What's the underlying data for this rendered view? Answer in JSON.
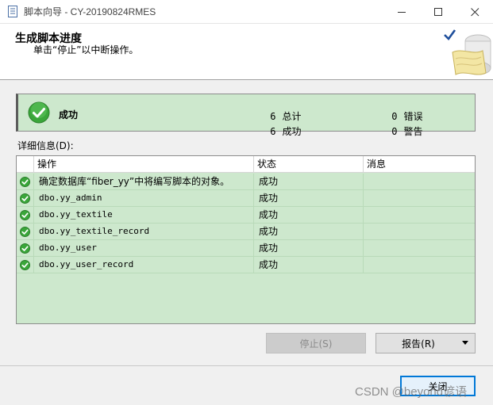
{
  "window": {
    "title": "脚本向导 - CY-20190824RMES",
    "icon": "script-doc-icon"
  },
  "header": {
    "title": "生成脚本进度",
    "subtitle": "单击“停止”以中断操作。",
    "art_icon": "checked-scroll-icon"
  },
  "summary": {
    "status": "成功",
    "status_icon": "success-check-icon",
    "total_count": "6",
    "total_label": "总计",
    "success_count": "6",
    "success_label": "成功",
    "error_count": "0",
    "error_label": "错误",
    "warning_count": "0",
    "warning_label": "警告",
    "background_color": "#cde8cd"
  },
  "details": {
    "label": "详细信息(D):",
    "columns": [
      "操作",
      "状态",
      "消息"
    ],
    "rows": [
      {
        "operation": "确定数据库“fiber_yy”中将编写脚本的对象。",
        "status": "成功",
        "message": ""
      },
      {
        "operation": "dbo.yy_admin",
        "status": "成功",
        "message": ""
      },
      {
        "operation": "dbo.yy_textile",
        "status": "成功",
        "message": ""
      },
      {
        "operation": "dbo.yy_textile_record",
        "status": "成功",
        "message": ""
      },
      {
        "operation": "dbo.yy_user",
        "status": "成功",
        "message": ""
      },
      {
        "operation": "dbo.yy_user_record",
        "status": "成功",
        "message": ""
      }
    ]
  },
  "buttons": {
    "stop": "停止(S)",
    "report": "报告(R)",
    "close": "关闭"
  },
  "watermark": "CSDN @beyond谚语",
  "colors": {
    "success_green": "#3aa63a",
    "accent_blue": "#0078d7"
  }
}
